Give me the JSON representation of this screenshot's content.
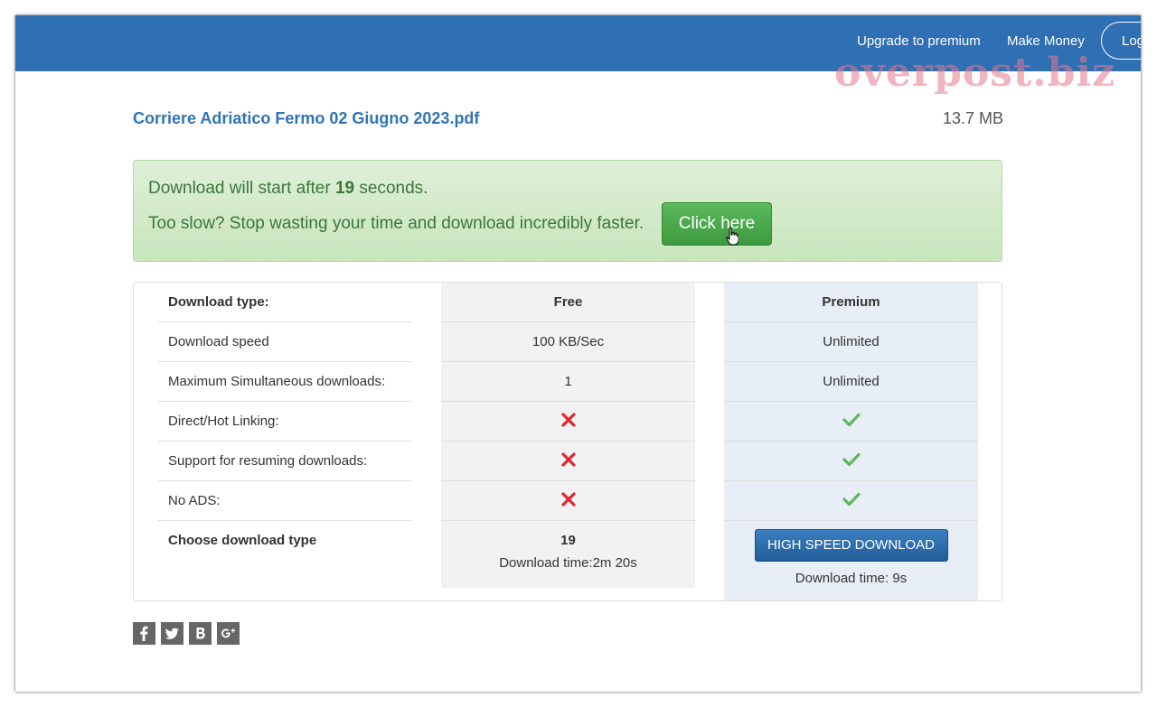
{
  "nav": {
    "upgrade": "Upgrade to premium",
    "make_money": "Make Money",
    "login": "Log"
  },
  "watermark": "overpost.biz",
  "file": {
    "name": "Corriere Adriatico Fermo 02 Giugno 2023.pdf",
    "size": "13.7 MB"
  },
  "alert": {
    "line1_prefix": "Download will start after ",
    "seconds": "19",
    "line1_suffix": " seconds.",
    "line2": "Too slow? Stop wasting your time and download incredibly faster.",
    "button": "Click here"
  },
  "table": {
    "header": {
      "label": "Download type:",
      "free": "Free",
      "premium": "Premium"
    },
    "rows": [
      {
        "label": "Download speed",
        "free": "100 KB/Sec",
        "premium": "Unlimited"
      },
      {
        "label": "Maximum Simultaneous downloads:",
        "free": "1",
        "premium": "Unlimited"
      },
      {
        "label": "Direct/Hot Linking:",
        "free_icon": "cross-icon",
        "premium_icon": "check-icon"
      },
      {
        "label": "Support for resuming downloads:",
        "free_icon": "cross-icon",
        "premium_icon": "check-icon"
      },
      {
        "label": "No ADS:",
        "free_icon": "cross-icon",
        "premium_icon": "check-icon"
      }
    ],
    "choose": {
      "label": "Choose download type",
      "free_count": "19",
      "free_time": "Download time:2m 20s",
      "premium_button": "HIGH SPEED DOWNLOAD",
      "premium_time": "Download time: 9s"
    }
  },
  "social": [
    "facebook-icon",
    "twitter-icon",
    "vk-icon",
    "google-plus-icon"
  ],
  "colors": {
    "navbar": "#2f6fb3",
    "link": "#2f74b5",
    "alert_bg": "#dff0d8",
    "success_button": "#4cae4c",
    "primary_button": "#2d6ca9",
    "cross": "#e0262e",
    "check": "#5cb85c"
  }
}
